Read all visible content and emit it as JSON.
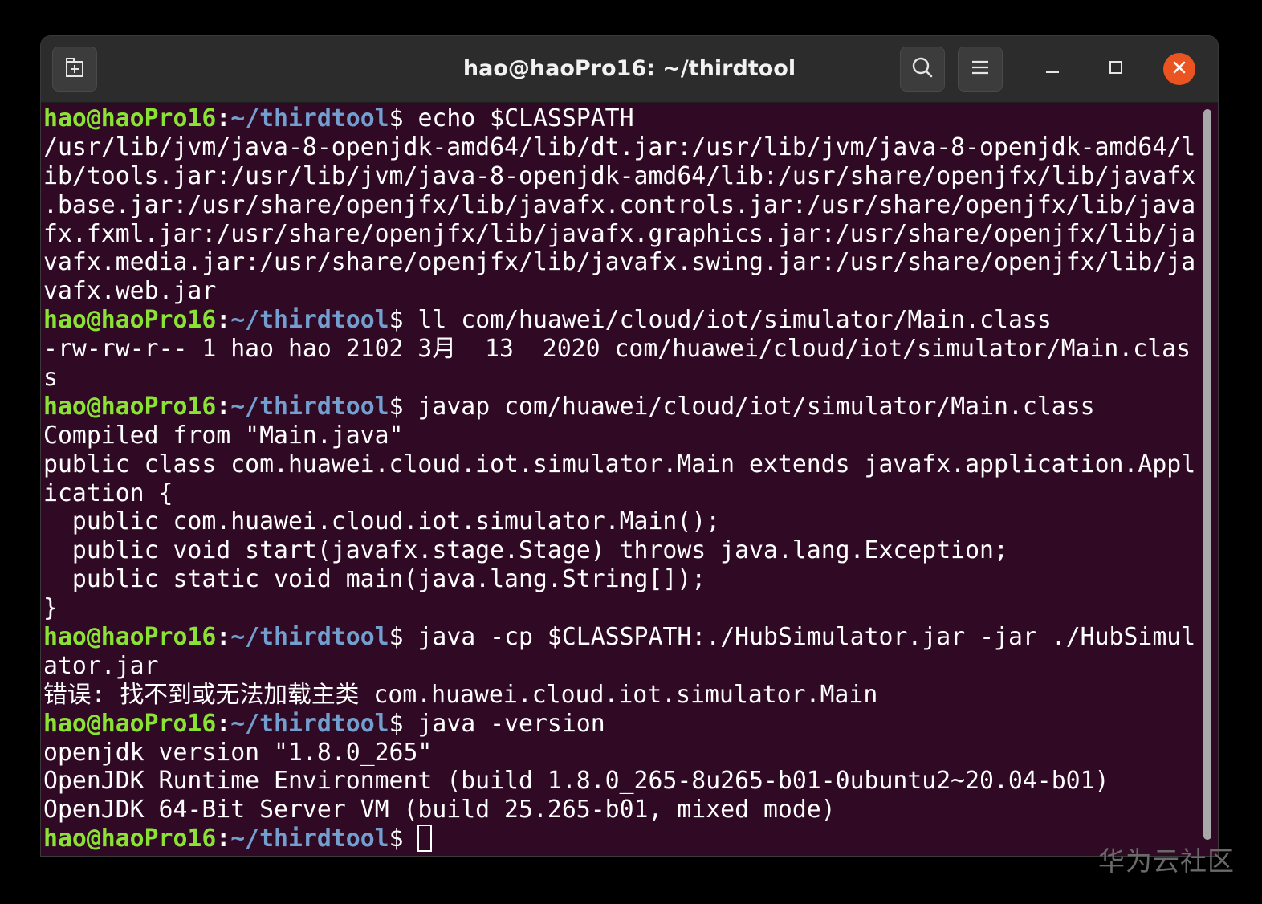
{
  "window": {
    "title": "hao@haoPro16: ~/thirdtool"
  },
  "titlebar": {
    "new_tab_icon": "new-tab-icon",
    "search_icon": "search-icon",
    "menu_icon": "hamburger-menu-icon",
    "minimize_icon": "minimize-icon",
    "maximize_icon": "maximize-icon",
    "close_icon": "close-icon"
  },
  "colors": {
    "terminal_bg": "#300a24",
    "prompt_user": "#8ae234",
    "prompt_path": "#729fcf",
    "close_button": "#e95420"
  },
  "prompt": {
    "user_host": "hao@haoPro16",
    "sep": ":",
    "path": "~/thirdtool",
    "dollar": "$"
  },
  "terminal": {
    "lines": [
      {
        "type": "prompt",
        "cmd": " echo $CLASSPATH"
      },
      {
        "type": "out",
        "text": "/usr/lib/jvm/java-8-openjdk-amd64/lib/dt.jar:/usr/lib/jvm/java-8-openjdk-amd64/l"
      },
      {
        "type": "out",
        "text": "ib/tools.jar:/usr/lib/jvm/java-8-openjdk-amd64/lib:/usr/share/openjfx/lib/javafx"
      },
      {
        "type": "out",
        "text": ".base.jar:/usr/share/openjfx/lib/javafx.controls.jar:/usr/share/openjfx/lib/java"
      },
      {
        "type": "out",
        "text": "fx.fxml.jar:/usr/share/openjfx/lib/javafx.graphics.jar:/usr/share/openjfx/lib/ja"
      },
      {
        "type": "out",
        "text": "vafx.media.jar:/usr/share/openjfx/lib/javafx.swing.jar:/usr/share/openjfx/lib/ja"
      },
      {
        "type": "out",
        "text": "vafx.web.jar"
      },
      {
        "type": "prompt",
        "cmd": " ll com/huawei/cloud/iot/simulator/Main.class"
      },
      {
        "type": "out",
        "text": "-rw-rw-r-- 1 hao hao 2102 3月  13  2020 com/huawei/cloud/iot/simulator/Main.clas"
      },
      {
        "type": "out",
        "text": "s"
      },
      {
        "type": "prompt",
        "cmd": " javap com/huawei/cloud/iot/simulator/Main.class"
      },
      {
        "type": "out",
        "text": "Compiled from \"Main.java\""
      },
      {
        "type": "out",
        "text": "public class com.huawei.cloud.iot.simulator.Main extends javafx.application.Appl"
      },
      {
        "type": "out",
        "text": "ication {"
      },
      {
        "type": "out",
        "text": "  public com.huawei.cloud.iot.simulator.Main();"
      },
      {
        "type": "out",
        "text": "  public void start(javafx.stage.Stage) throws java.lang.Exception;"
      },
      {
        "type": "out",
        "text": "  public static void main(java.lang.String[]);"
      },
      {
        "type": "out",
        "text": "}"
      },
      {
        "type": "prompt",
        "cmd": " java -cp $CLASSPATH:./HubSimulator.jar -jar ./HubSimul"
      },
      {
        "type": "out",
        "text": "ator.jar"
      },
      {
        "type": "out",
        "text": "错误: 找不到或无法加载主类 com.huawei.cloud.iot.simulator.Main"
      },
      {
        "type": "prompt",
        "cmd": " java -version"
      },
      {
        "type": "out",
        "text": "openjdk version \"1.8.0_265\""
      },
      {
        "type": "out",
        "text": "OpenJDK Runtime Environment (build 1.8.0_265-8u265-b01-0ubuntu2~20.04-b01)"
      },
      {
        "type": "out",
        "text": "OpenJDK 64-Bit Server VM (build 25.265-b01, mixed mode)"
      },
      {
        "type": "prompt",
        "cmd": " ",
        "cursor": true
      }
    ]
  },
  "watermark": "华为云社区"
}
